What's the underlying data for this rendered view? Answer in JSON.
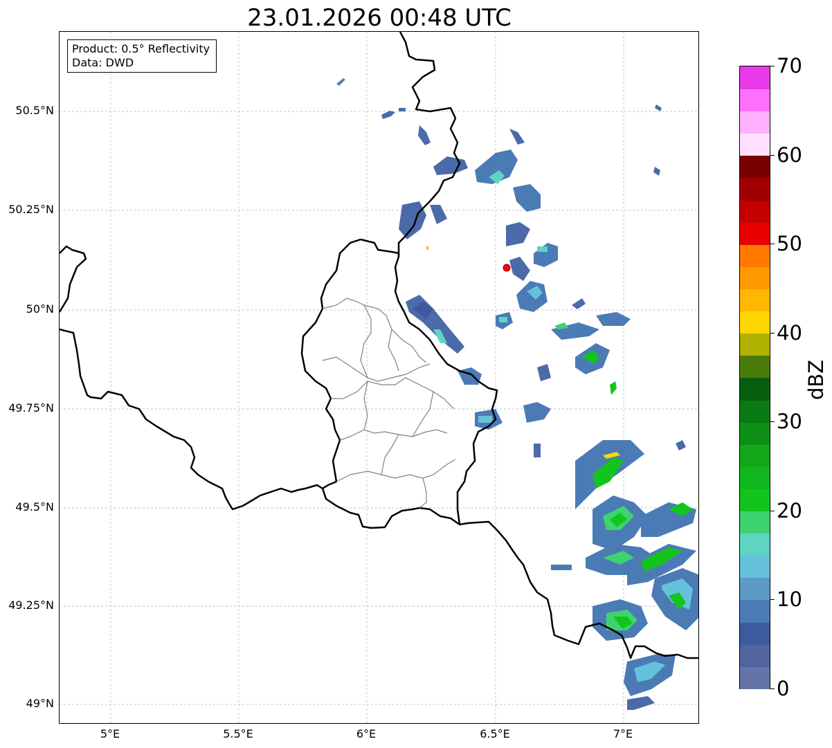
{
  "title": "23.01.2026 00:48 UTC",
  "info_box": {
    "product": "Product: 0.5° Reflectivity",
    "data": "Data: DWD"
  },
  "map": {
    "lon_range": [
      4.8,
      7.3
    ],
    "lat_range": [
      48.95,
      50.7
    ],
    "grid": true,
    "x_ticks": [
      {
        "value": 5.0,
        "label": "5°E"
      },
      {
        "value": 5.5,
        "label": "5.5°E"
      },
      {
        "value": 6.0,
        "label": "6°E"
      },
      {
        "value": 6.5,
        "label": "6.5°E"
      },
      {
        "value": 7.0,
        "label": "7°E"
      }
    ],
    "y_ticks": [
      {
        "value": 50.5,
        "label": "50.5°N"
      },
      {
        "value": 50.25,
        "label": "50.25°N"
      },
      {
        "value": 50.0,
        "label": "50°N"
      },
      {
        "value": 49.75,
        "label": "49.75°N"
      },
      {
        "value": 49.5,
        "label": "49.5°N"
      },
      {
        "value": 49.25,
        "label": "49.25°N"
      },
      {
        "value": 49.0,
        "label": "49°N"
      }
    ],
    "radar_site": {
      "lon": 6.55,
      "lat": 50.11,
      "color": "#ff0000"
    }
  },
  "colorbar": {
    "label": "dBZ",
    "min": 0,
    "max": 70,
    "ticks": [
      "0",
      "10",
      "20",
      "30",
      "40",
      "50",
      "60",
      "70"
    ],
    "colors": [
      "#6474a8",
      "#50649f",
      "#3e5a9e",
      "#4a7bb4",
      "#5b9bc6",
      "#66c1db",
      "#5ed5c1",
      "#3dd36f",
      "#12c41c",
      "#10b71c",
      "#10a817",
      "#0d8f16",
      "#0a7a12",
      "#085e0f",
      "#497a0a",
      "#b0b000",
      "#ffd600",
      "#ffb700",
      "#ff9a00",
      "#ff7a00",
      "#e80000",
      "#c40000",
      "#a00000",
      "#7a0000",
      "#ffe0ff",
      "#ffb0ff",
      "#ff70ff",
      "#e83ae8"
    ]
  }
}
